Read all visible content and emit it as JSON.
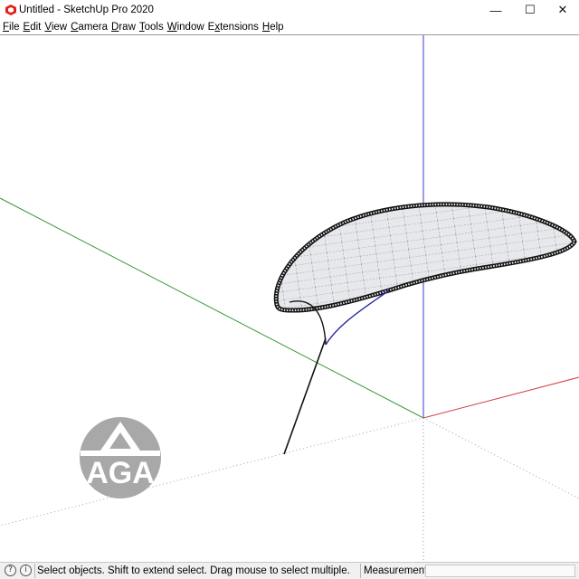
{
  "window": {
    "title": "Untitled - SketchUp Pro 2020",
    "minimize_glyph": "—",
    "maximize_glyph": "☐",
    "close_glyph": "✕"
  },
  "menu": {
    "items": [
      {
        "label": "File",
        "accel": "F"
      },
      {
        "label": "Edit",
        "accel": "E"
      },
      {
        "label": "View",
        "accel": "V"
      },
      {
        "label": "Camera",
        "accel": "C"
      },
      {
        "label": "Draw",
        "accel": "D"
      },
      {
        "label": "Tools",
        "accel": "T"
      },
      {
        "label": "Window",
        "accel": "W"
      },
      {
        "label": "Extensions",
        "accel": "x"
      },
      {
        "label": "Help",
        "accel": "H"
      }
    ]
  },
  "viewport": {
    "axis_colors": {
      "red": "#d04040",
      "green": "#3a9a3a",
      "blue": "#3a3acb"
    },
    "watermark_text": "AGA",
    "watermark_color": "#b0b0b0"
  },
  "status": {
    "geo_icon": "geolocation-icon",
    "info_icon": "info-icon",
    "message": "Select objects. Shift to extend select. Drag mouse to select multiple.",
    "measurements_label": "Measurements",
    "measurements_value": ""
  }
}
